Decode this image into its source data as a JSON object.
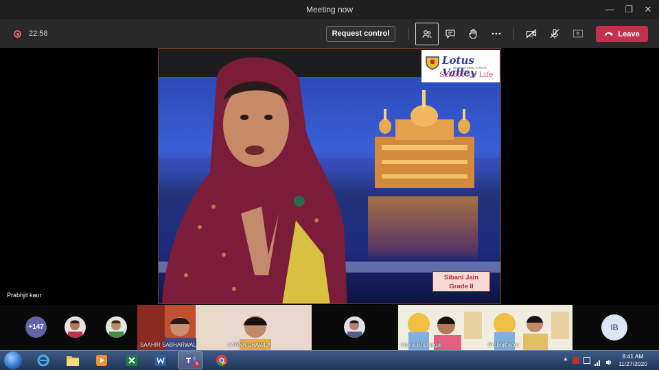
{
  "window": {
    "title": "Meeting now",
    "minimize_icon": "minimize-icon",
    "maximize_icon": "restore-icon",
    "close_icon": "close-icon"
  },
  "toolbar": {
    "recording_icon": "record-icon",
    "timer": "22:58",
    "request_control_label": "Request control",
    "icons": [
      "people-icon",
      "chat-icon",
      "raise-hand-icon",
      "more-options-icon",
      "camera-off-icon",
      "mic-off-icon",
      "share-tray-icon"
    ],
    "leave_label": "Leave",
    "leave_color": "#c4314b"
  },
  "stage": {
    "logo_name": "Lotus Valley",
    "logo_subtitle": "INTERNATIONAL SCHOOL GURUGRAM",
    "logo_tagline": "School for Life",
    "name_tag_line1": "Sibani Jain",
    "name_tag_line2": "Grade II"
  },
  "speaker_name": "Prabhjit kaur",
  "gallery": {
    "overflow_count": "+147",
    "participants": [
      {
        "name": "SAAHIR SABHARWAL"
      },
      {
        "name": "AARNA CHAWLA"
      },
      {
        "name": "Mansi Bhatnagar"
      },
      {
        "name": "Prabhjit kaur"
      }
    ],
    "initials": "IB"
  },
  "taskbar": {
    "apps": [
      "windows-start-icon",
      "internet-explorer-icon",
      "file-explorer-icon",
      "media-player-icon",
      "excel-icon",
      "word-icon",
      "teams-icon",
      "chrome-icon"
    ],
    "teams_badge": "5",
    "time": "8:41 AM",
    "date": "11/27/2020"
  }
}
